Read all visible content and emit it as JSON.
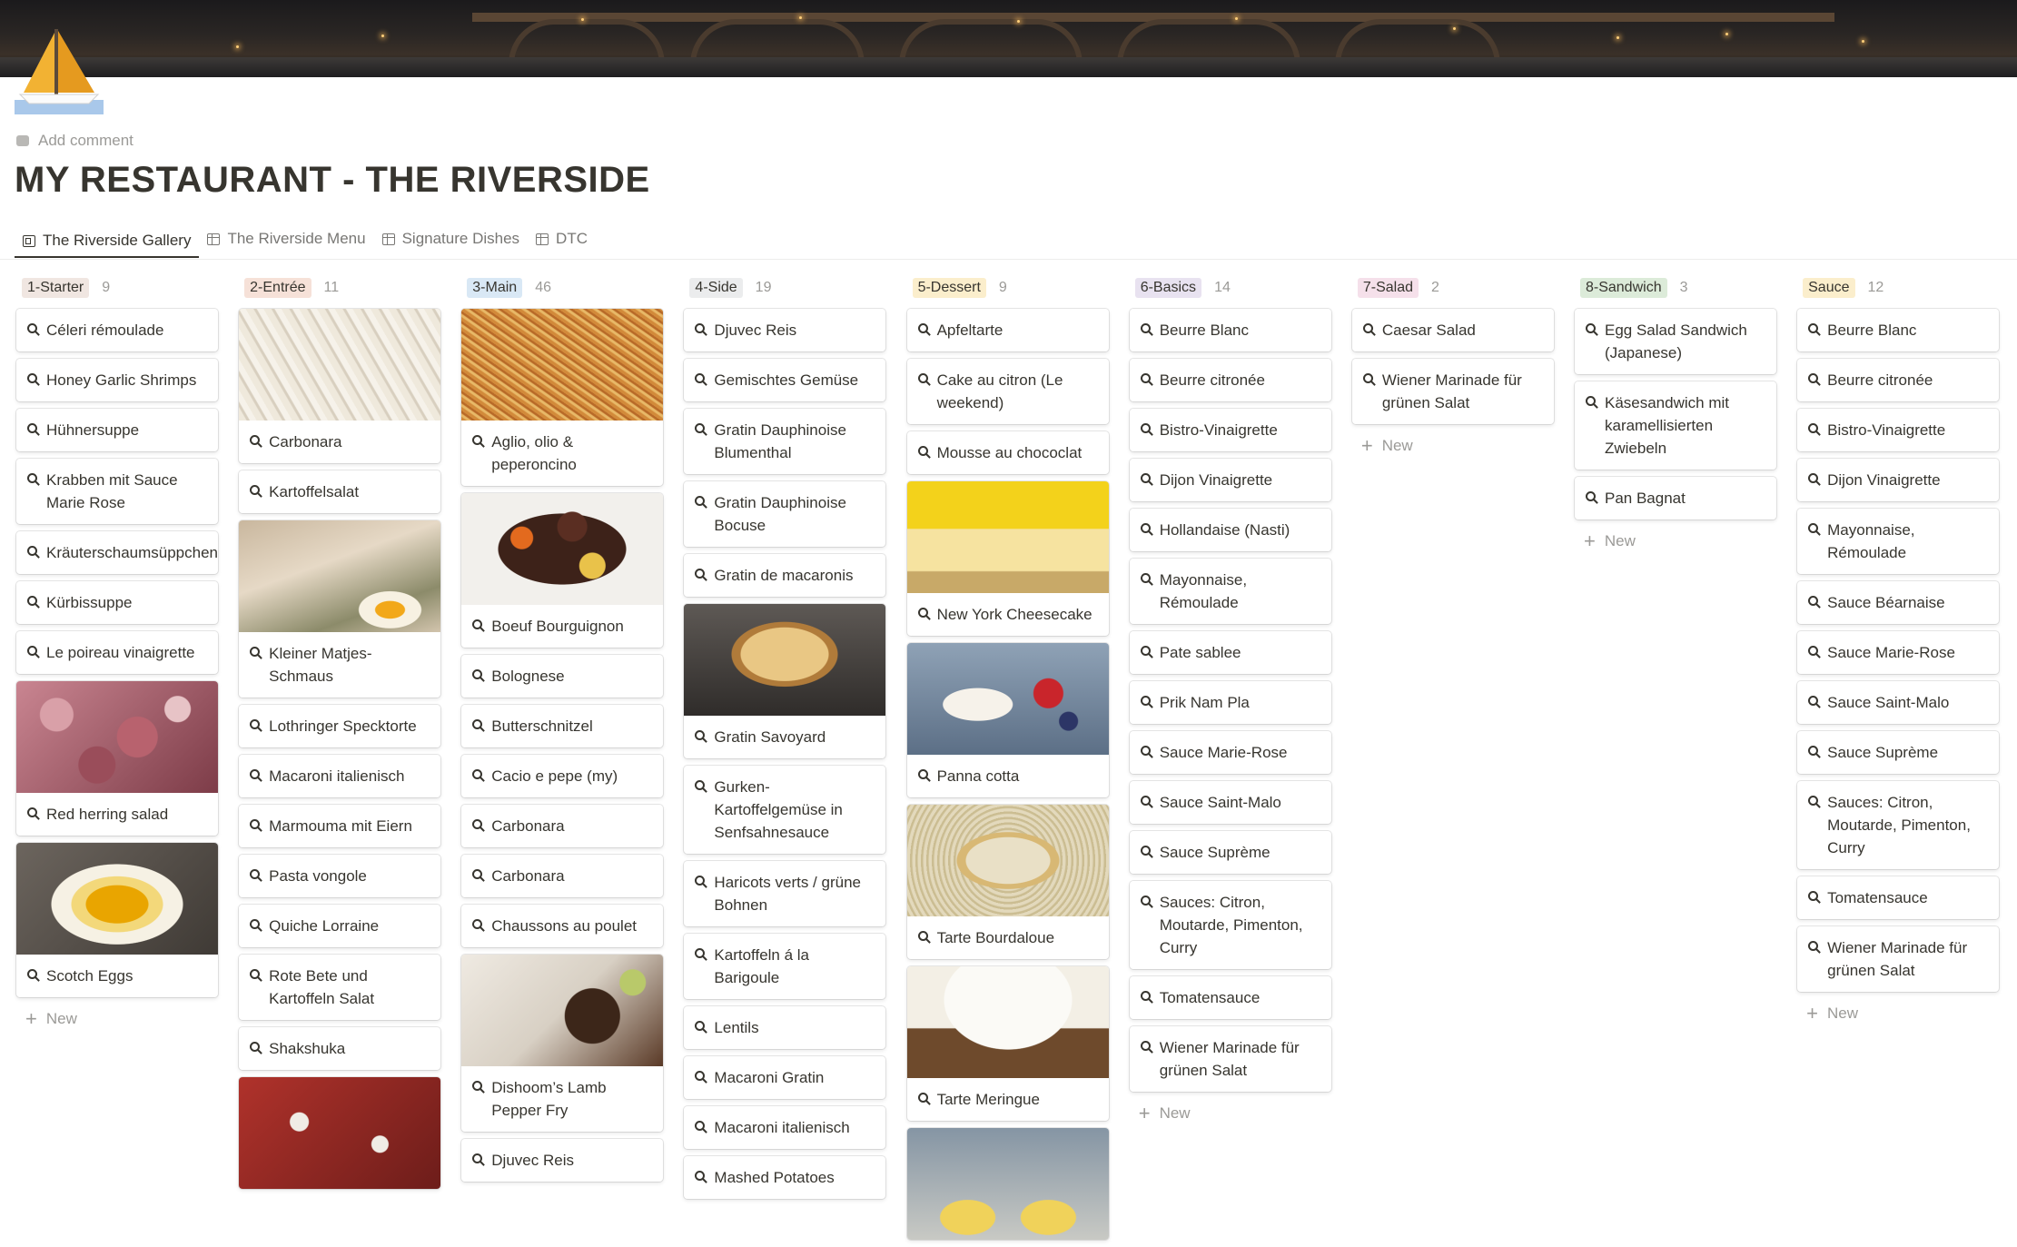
{
  "page": {
    "add_comment": "Add comment",
    "title": "MY RESTAURANT - THE RIVERSIDE"
  },
  "tabs": [
    {
      "label": "The Riverside Gallery",
      "icon": "gallery-icon",
      "active": true
    },
    {
      "label": "The Riverside Menu",
      "icon": "table-icon",
      "active": false
    },
    {
      "label": "Signature Dishes",
      "icon": "table-icon",
      "active": false
    },
    {
      "label": "DTC",
      "icon": "table-icon",
      "active": false
    }
  ],
  "new_label": "New",
  "colors": {
    "tag_brown": "#f4eeee",
    "tag_orange": "#fbecdd",
    "tag_blue": "#e7f3f8",
    "tag_gray": "#ebeced",
    "tag_yellow": "#fbf3db",
    "tag_purple": "#f4f0f7",
    "tag_pink": "#f9eef3",
    "tag_green": "#edf3ec",
    "tag_gold": "#fbf3db"
  },
  "columns": [
    {
      "tag": "1-Starter",
      "count": "9",
      "tag_color": "#f0e6e1",
      "show_new": true,
      "cards": [
        {
          "label": "Céleri rémoulade"
        },
        {
          "label": "Honey Garlic Shrimps"
        },
        {
          "label": "Hühnersuppe"
        },
        {
          "label": "Krabben mit Sauce Marie Rose"
        },
        {
          "label": "Kräuterschaumsüppchen"
        },
        {
          "label": "Kürbissuppe"
        },
        {
          "label": "Le poireau vinaigrette"
        },
        {
          "label": "Red herring salad",
          "image": "meat-salad"
        },
        {
          "label": "Scotch Eggs",
          "image": "egg"
        }
      ]
    },
    {
      "tag": "2-Entrée",
      "count": "11",
      "tag_color": "#f6e1d8",
      "show_new": false,
      "cards": [
        {
          "label": "Carbonara",
          "image": "noodles"
        },
        {
          "label": "Kartoffelsalat"
        },
        {
          "label": "Kleiner Matjes-Schmaus",
          "image": "herring"
        },
        {
          "label": "Lothringer Specktorte"
        },
        {
          "label": "Macaroni italienisch"
        },
        {
          "label": "Marmouma mit Eiern"
        },
        {
          "label": "Pasta vongole"
        },
        {
          "label": "Quiche Lorraine"
        },
        {
          "label": "Rote Bete und Kartoffeln Salat"
        },
        {
          "label": "Shakshuka"
        },
        {
          "label": "",
          "image": "tomato"
        }
      ]
    },
    {
      "tag": "3-Main",
      "count": "46",
      "tag_color": "#d9e8f5",
      "show_new": false,
      "cards": [
        {
          "label": "Aglio, olio & peperoncino",
          "image": "spaghetti"
        },
        {
          "label": "Boeuf Bourguignon",
          "image": "stew"
        },
        {
          "label": "Bolognese"
        },
        {
          "label": "Butterschnitzel"
        },
        {
          "label": "Cacio e pepe (my)"
        },
        {
          "label": "Carbonara"
        },
        {
          "label": "Carbonara"
        },
        {
          "label": "Chaussons au poulet"
        },
        {
          "label": "Dishoom’s Lamb Pepper Fry",
          "image": "rice-lamb"
        },
        {
          "label": "Djuvec Reis"
        }
      ]
    },
    {
      "tag": "4-Side",
      "count": "19",
      "tag_color": "#ebeced",
      "show_new": false,
      "cards": [
        {
          "label": "Djuvec Reis"
        },
        {
          "label": "Gemischtes Gemüse"
        },
        {
          "label": "Gratin Dauphinoise Blumenthal"
        },
        {
          "label": "Gratin Dauphinoise Bocuse"
        },
        {
          "label": "Gratin de macaronis"
        },
        {
          "label": "Gratin Savoyard",
          "image": "gratin"
        },
        {
          "label": "Gurken-Kartoffelgemüse in Senfsahnesauce"
        },
        {
          "label": "Haricots verts / grüne Bohnen"
        },
        {
          "label": "Kartoffeln á la Barigoule"
        },
        {
          "label": "Lentils"
        },
        {
          "label": "Macaroni Gratin"
        },
        {
          "label": "Macaroni italienisch"
        },
        {
          "label": "Mashed Potatoes"
        }
      ]
    },
    {
      "tag": "5-Dessert",
      "count": "9",
      "tag_color": "#fbeecc",
      "show_new": false,
      "cards": [
        {
          "label": "Apfeltarte"
        },
        {
          "label": "Cake au citron (Le weekend)"
        },
        {
          "label": "Mousse au chococlat"
        },
        {
          "label": "New York Cheesecake",
          "image": "cheesecake"
        },
        {
          "label": "Panna cotta",
          "image": "panna"
        },
        {
          "label": "Tarte Bourdaloue",
          "image": "tart"
        },
        {
          "label": "Tarte Meringue",
          "image": "meringue"
        },
        {
          "label": "",
          "image": "tartlets"
        }
      ]
    },
    {
      "tag": "6-Basics",
      "count": "14",
      "tag_color": "#e8e2f0",
      "show_new": true,
      "cards": [
        {
          "label": "Beurre Blanc"
        },
        {
          "label": "Beurre citronée"
        },
        {
          "label": "Bistro-Vinaigrette"
        },
        {
          "label": "Dijon Vinaigrette"
        },
        {
          "label": "Hollandaise (Nasti)"
        },
        {
          "label": "Mayonnaise, Rémoulade"
        },
        {
          "label": "Pate sablee"
        },
        {
          "label": "Prik Nam Pla"
        },
        {
          "label": "Sauce Marie-Rose"
        },
        {
          "label": "Sauce Saint-Malo"
        },
        {
          "label": "Sauce Suprème"
        },
        {
          "label": "Sauces: Citron, Moutarde, Pimenton, Curry"
        },
        {
          "label": "Tomatensauce"
        },
        {
          "label": "Wiener Marinade für grünen Salat"
        }
      ]
    },
    {
      "tag": "7-Salad",
      "count": "2",
      "tag_color": "#f5e0ea",
      "show_new": true,
      "cards": [
        {
          "label": "Caesar Salad"
        },
        {
          "label": "Wiener Marinade für grünen Salat"
        }
      ]
    },
    {
      "tag": "8-Sandwich",
      "count": "3",
      "tag_color": "#dcebd9",
      "show_new": true,
      "cards": [
        {
          "label": "Egg Salad Sandwich (Japanese)"
        },
        {
          "label": "Käsesandwich mit karamellisierten Zwiebeln"
        },
        {
          "label": "Pan Bagnat"
        }
      ]
    },
    {
      "tag": "Sauce",
      "count": "12",
      "tag_color": "#fbeecc",
      "show_new": true,
      "cards": [
        {
          "label": "Beurre Blanc"
        },
        {
          "label": "Beurre citronée"
        },
        {
          "label": "Bistro-Vinaigrette"
        },
        {
          "label": "Dijon Vinaigrette"
        },
        {
          "label": "Mayonnaise, Rémoulade"
        },
        {
          "label": "Sauce Béarnaise"
        },
        {
          "label": "Sauce Marie-Rose"
        },
        {
          "label": "Sauce Saint-Malo"
        },
        {
          "label": "Sauce Suprème"
        },
        {
          "label": "Sauces: Citron, Moutarde, Pimenton, Curry"
        },
        {
          "label": "Tomatensauce"
        },
        {
          "label": "Wiener Marinade für grünen Salat"
        }
      ]
    }
  ]
}
